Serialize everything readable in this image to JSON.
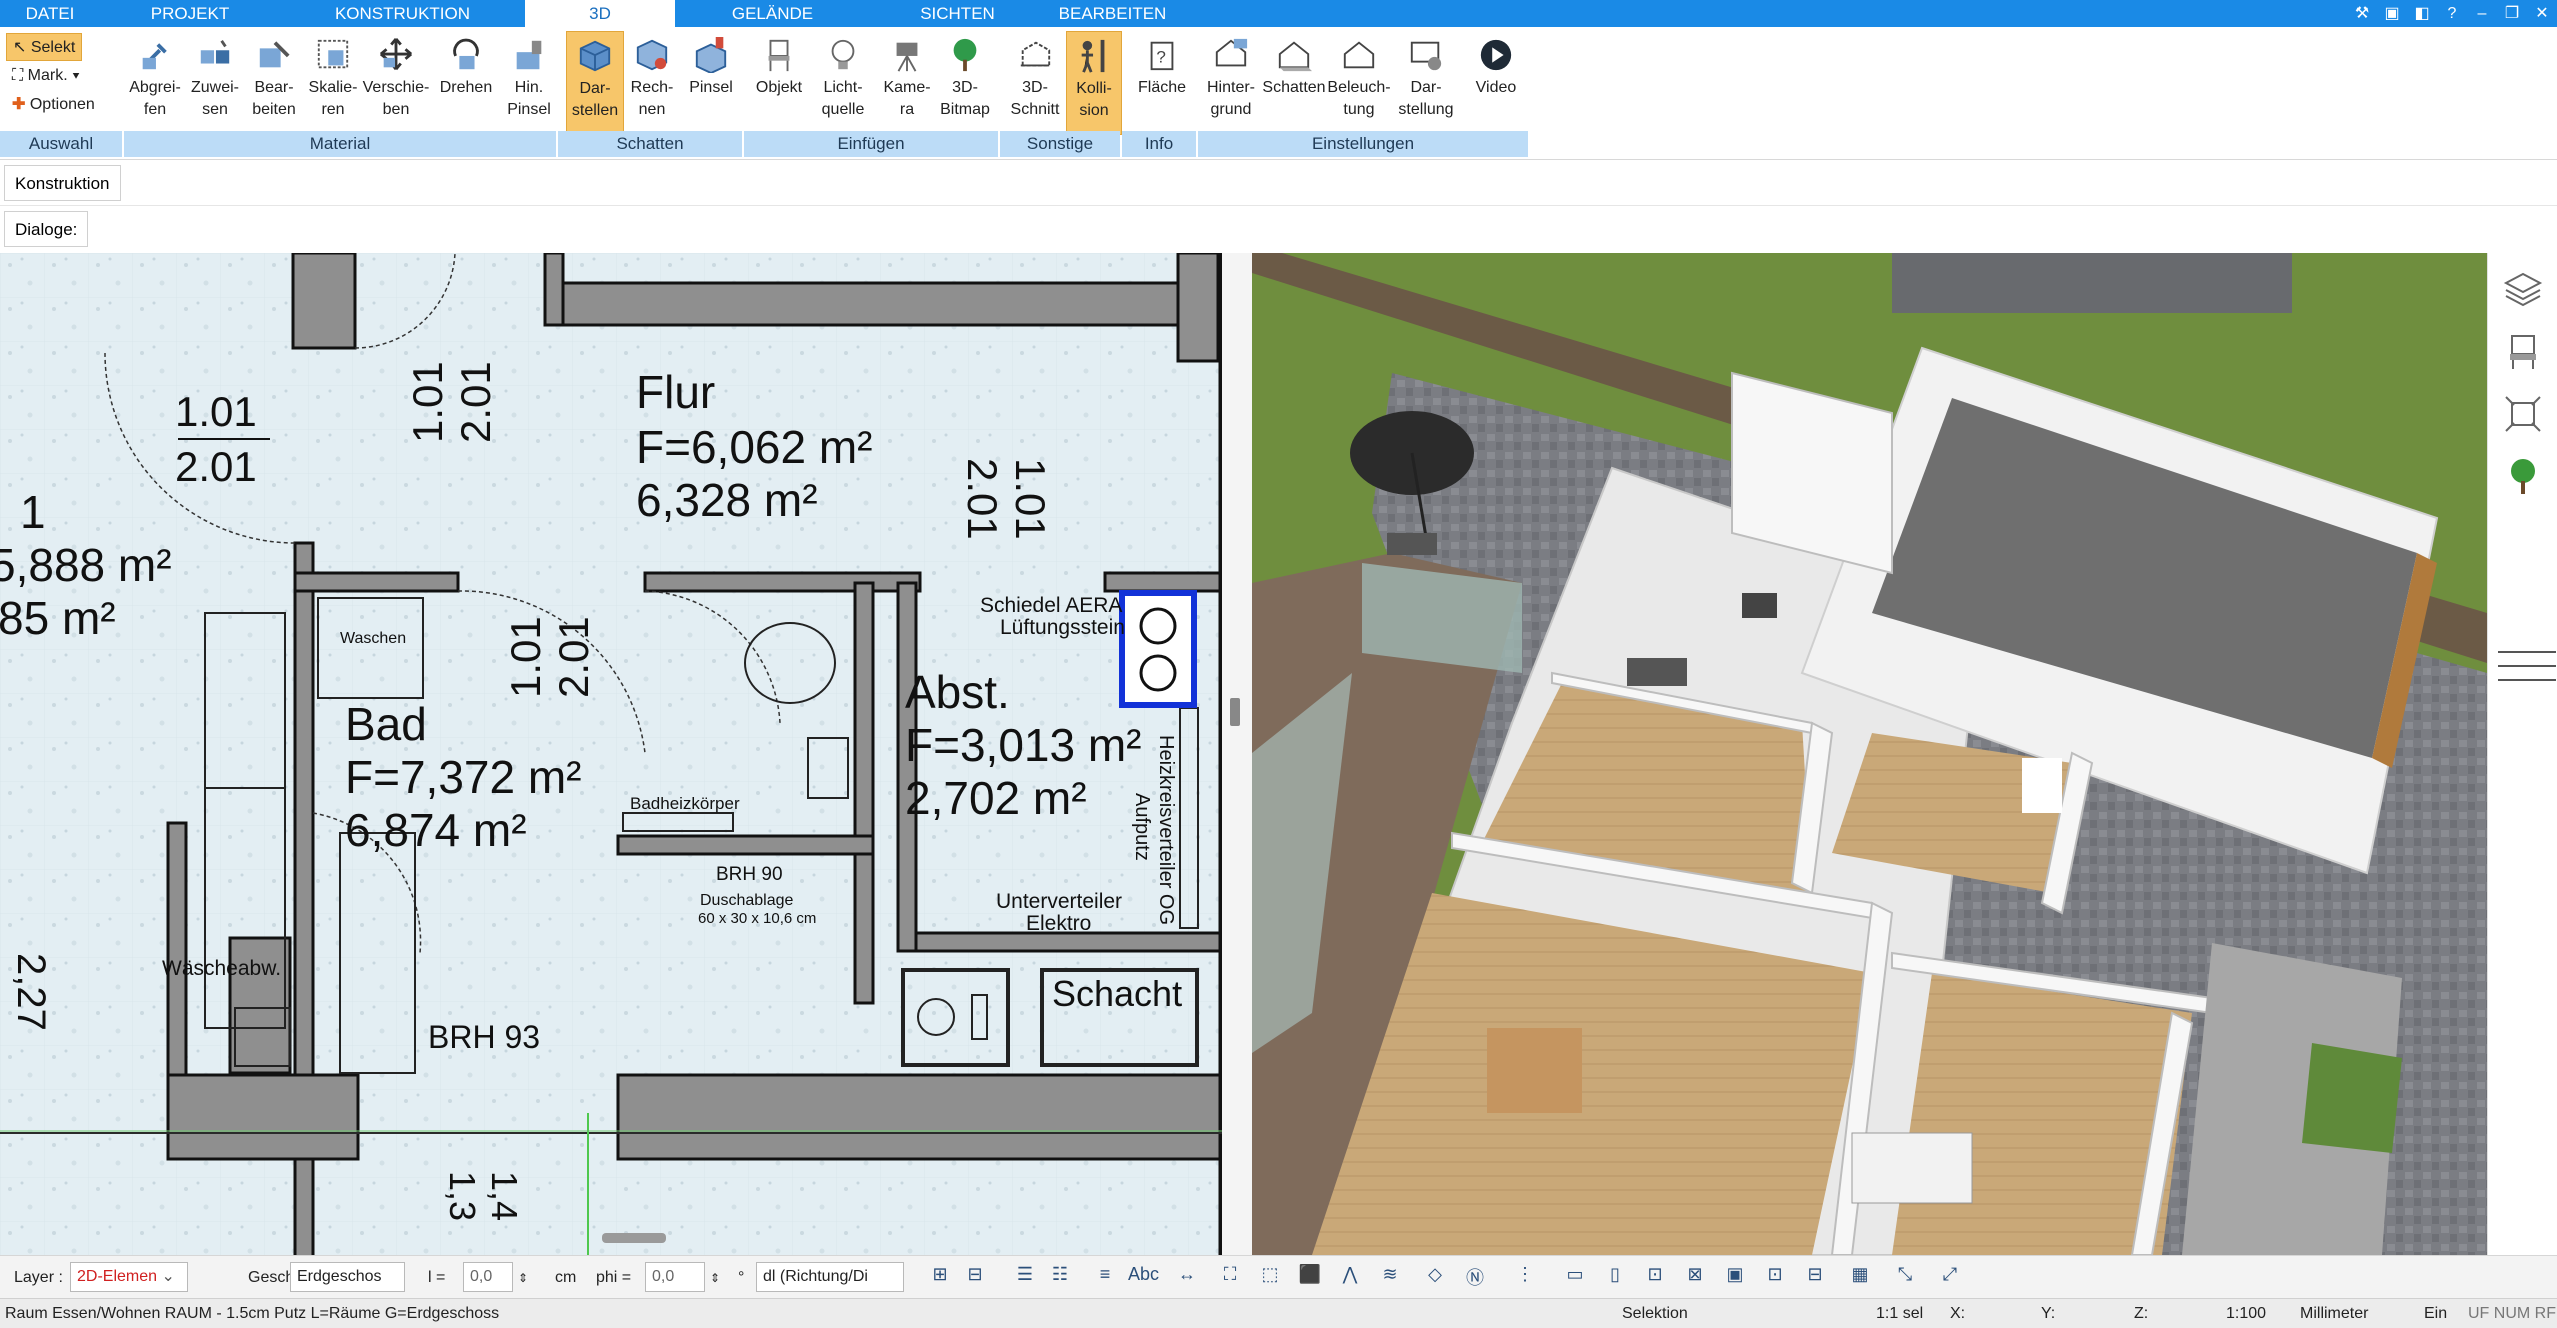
{
  "tabs": [
    {
      "label": "DATEI"
    },
    {
      "label": "PROJEKT"
    },
    {
      "label": "KONSTRUKTION"
    },
    {
      "label": "3D"
    },
    {
      "label": "GELÄNDE"
    },
    {
      "label": "SICHTEN"
    },
    {
      "label": "BEARBEITEN"
    }
  ],
  "active_tab": "3D",
  "auswahl": {
    "selekt": "Selekt",
    "mark": "Mark.",
    "optionen": "Optionen",
    "group_label": "Auswahl"
  },
  "groups": {
    "material": "Material",
    "schatten": "Schatten",
    "einfuegen": "Einfügen",
    "sonstige": "Sonstige",
    "info": "Info",
    "einstellungen": "Einstellungen"
  },
  "ribbon_buttons": [
    {
      "l1": "Abgrei-",
      "l2": "fen",
      "icon": "eyedropper-icon"
    },
    {
      "l1": "Zuwei-",
      "l2": "sen",
      "icon": "assign-material-icon"
    },
    {
      "l1": "Bear-",
      "l2": "beiten",
      "icon": "edit-material-icon"
    },
    {
      "l1": "Skalie-",
      "l2": "ren",
      "icon": "scale-icon"
    },
    {
      "l1": "Verschie-",
      "l2": "ben",
      "icon": "move-icon"
    },
    {
      "l1": "Drehen",
      "l2": "",
      "icon": "rotate-icon"
    },
    {
      "l1": "Hin.",
      "l2": "Pinsel",
      "icon": "brush-icon"
    },
    {
      "l1": "Dar-",
      "l2": "stellen",
      "icon": "cube-display-icon"
    },
    {
      "l1": "Rech-",
      "l2": "nen",
      "icon": "cube-compute-icon"
    },
    {
      "l1": "Pinsel",
      "l2": "",
      "icon": "cube-brush-icon"
    },
    {
      "l1": "Objekt",
      "l2": "",
      "icon": "chair-icon"
    },
    {
      "l1": "Licht-",
      "l2": "quelle",
      "icon": "lightbulb-icon"
    },
    {
      "l1": "Kame-",
      "l2": "ra",
      "icon": "camera-icon"
    },
    {
      "l1": "3D-",
      "l2": "Bitmap",
      "icon": "tree-icon"
    },
    {
      "l1": "3D-",
      "l2": "Schnitt",
      "icon": "section-cut-icon"
    },
    {
      "l1": "Kolli-",
      "l2": "sion",
      "icon": "collision-icon"
    },
    {
      "l1": "Fläche",
      "l2": "",
      "icon": "area-info-icon"
    },
    {
      "l1": "Hinter-",
      "l2": "grund",
      "icon": "background-house-icon"
    },
    {
      "l1": "Schatten",
      "l2": "",
      "icon": "shadow-house-icon"
    },
    {
      "l1": "Beleuch-",
      "l2": "tung",
      "icon": "lighting-house-icon"
    },
    {
      "l1": "Dar-",
      "l2": "stellung",
      "icon": "display-settings-icon"
    },
    {
      "l1": "Video",
      "l2": "",
      "icon": "play-video-icon"
    }
  ],
  "konstruktion_tab": "Konstruktion",
  "dialoge_label": "Dialoge:",
  "plan": {
    "door_labels": [
      "1.01",
      "2.01",
      "1.01",
      "2.01",
      "1.01",
      "2.01",
      "1.01",
      "2.01"
    ],
    "flur_name": "Flur",
    "flur_f": "F=6,062 m²",
    "flur_a": "6,328 m²",
    "room1_num": "1",
    "room1_f": "5,888 m²",
    "room1_a": "85 m²",
    "bad_name": "Bad",
    "bad_f": "F=7,372 m²",
    "bad_a": "6,874 m²",
    "abst_name": "Abst.",
    "abst_f": "F=3,013 m²",
    "abst_a": "2,702 m²",
    "waschen": "Waschen",
    "waescheabw": "Wäscheabw.",
    "badheiz": "Badheizkörper",
    "brh90": "BRH 90",
    "duschablage1": "Duschablage",
    "duschablage2": "60 x 30 x 10,6 cm",
    "schiedel1": "Schiedel AERA",
    "schiedel2": "Lüftungsstein",
    "heizkreis1": "Heizkreisverteiler OG",
    "heizkreis2": "Aufputz",
    "unterverteiler1": "Unterverteiler",
    "unterverteiler2": "Elektro",
    "schacht": "Schacht",
    "brh93": "BRH 93",
    "dim_left": "2,27",
    "dim_bottom1": "1,3",
    "dim_bottom2": "1,4"
  },
  "bottom_toolbar": {
    "layer_label": "Layer :",
    "layer_value": "2D-Elemen",
    "geschoss_label": "Geschoss :",
    "geschoss_value": "Erdgeschos",
    "l_label": "l =",
    "l_value": "0,0",
    "l_unit": "cm",
    "phi_label": "phi =",
    "phi_value": "0,0",
    "phi_unit": "°",
    "mode_value": "dl (Richtung/Di"
  },
  "status_bar": {
    "message": "Raum Essen/Wohnen RAUM - 1.5cm Putz L=Räume G=Erdgeschoss",
    "mode": "Selektion",
    "sel": "1:1 sel",
    "x": "X:",
    "y": "Y:",
    "z": "Z:",
    "scale": "1:100",
    "unit": "Millimeter",
    "ein": "Ein",
    "flags": "UF NUM RF"
  },
  "colors": {
    "tab_blue": "#1a8ae6",
    "group_label_bg": "#bcdcf7",
    "active_button": "#f7c66a",
    "plan_floor": "#e3eef3",
    "wall": "#8f8f8f",
    "grass": "#6f8e3e",
    "wood_floor": "#c8a97a"
  }
}
